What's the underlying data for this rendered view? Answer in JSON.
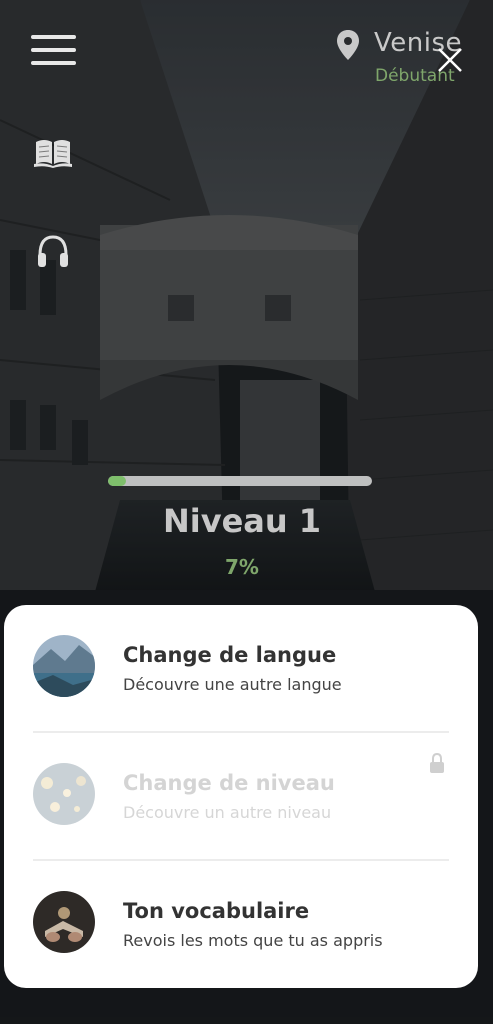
{
  "header": {
    "city": "Venise",
    "level_label": "Débutant",
    "icons": {
      "menu": "hamburger-menu-icon",
      "book": "book-icon",
      "headset": "headphones-icon",
      "location": "location-pin-icon",
      "close": "close-icon"
    }
  },
  "progress": {
    "title": "Niveau 1",
    "percent_text": "7%",
    "value": 0.07,
    "colors": {
      "fill": "#7fbf6c",
      "track": "#bfc0c0",
      "accent_text": "#7fa66b"
    }
  },
  "menu_card": {
    "items": [
      {
        "title": "Change de langue",
        "subtitle": "Découvre une autre langue",
        "enabled": true,
        "thumb": "mountain-lake-photo"
      },
      {
        "title": "Change de niveau",
        "subtitle": "Découvre un autre niveau",
        "enabled": false,
        "locked": true,
        "thumb": "bokeh-lights-photo"
      },
      {
        "title": "Ton vocabulaire",
        "subtitle": "Revois les mots que tu as appris",
        "enabled": true,
        "thumb": "book-hands-photo"
      }
    ]
  }
}
